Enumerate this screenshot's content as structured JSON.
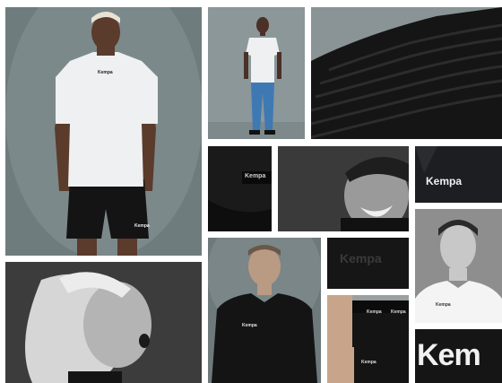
{
  "brand": {
    "wordmark": "Kempa"
  },
  "colors": {
    "studio_bg": "#6f7c7e",
    "studio_bg_light": "#8b9799",
    "black_fabric": "#141414",
    "white_shirt": "#eef0f2",
    "skin": "#5a3b2c",
    "jeans": "#3f79b4",
    "mono_bg": "#3a3a3a",
    "wordmark_white": "#f2f2f2",
    "wordmark_dark": "#3a3a3a"
  },
  "tiles": {
    "player_tshirt": {
      "logo": "Kempa",
      "shorts_logo": "Kempa"
    },
    "woman_shirt_jeans": {},
    "fabric_waistband": {},
    "sleeve_patch": {
      "logo": "Kempa"
    },
    "man_laughing_bw": {},
    "polo_chest": {
      "logo": "Kempa"
    },
    "woman_shouting_bw": {},
    "man_polo": {
      "logo": "Kempa"
    },
    "tonal_logo": {
      "logo": "Kempa"
    },
    "man_portrait_bw": {
      "logo": "Kempa"
    },
    "shorts_waistband": {
      "logo_left": "Kempa",
      "logo_right": "Kempa",
      "leg_logo": "Kempa"
    },
    "big_logo_closeup": {
      "logo": "Kem"
    }
  }
}
